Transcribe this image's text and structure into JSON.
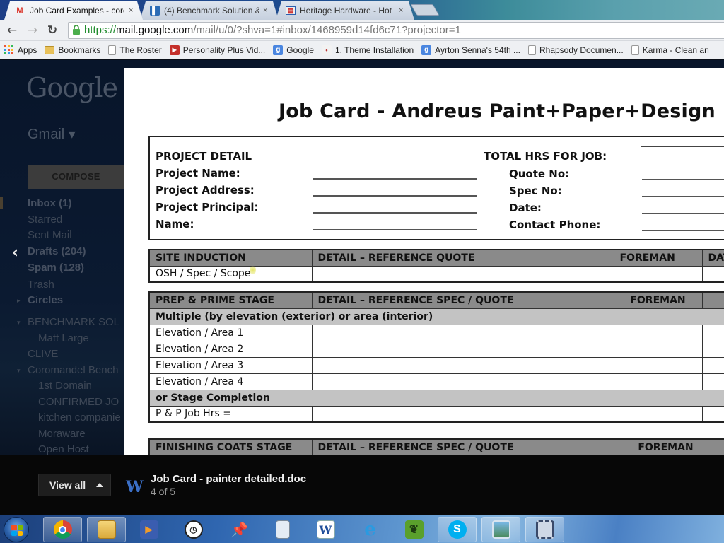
{
  "browser": {
    "tabs": [
      {
        "title": "Job Card Examples - corol",
        "favicon": "gmail-icon",
        "active": true
      },
      {
        "title": "(4) Benchmark Solution &",
        "favicon": "trello-icon",
        "active": false
      },
      {
        "title": "Heritage Hardware - Hot I",
        "favicon": "site-icon",
        "active": false
      }
    ],
    "tab_close_glyph": "×",
    "url": {
      "scheme": "https://",
      "host": "mail.google.com",
      "path": "/mail/u/0/?shva=1#inbox/1468959d14fd6c71?projector=1"
    },
    "nav": {
      "back": "←",
      "forward": "→",
      "reload": "↻"
    },
    "bookmarks": [
      {
        "label": "Apps",
        "icon": "apps-grid-icon"
      },
      {
        "label": "Bookmarks",
        "icon": "folder-icon"
      },
      {
        "label": "The Roster",
        "icon": "page-icon"
      },
      {
        "label": "Personality Plus Vid...",
        "icon": "youtube-icon"
      },
      {
        "label": "Google",
        "icon": "google-icon"
      },
      {
        "label": "1. Theme Installation",
        "icon": "site-icon"
      },
      {
        "label": "Ayrton Senna's 54th ...",
        "icon": "google-icon"
      },
      {
        "label": "Rhapsody Documen...",
        "icon": "page-icon"
      },
      {
        "label": "Karma - Clean an",
        "icon": "page-icon"
      }
    ]
  },
  "gmail": {
    "logo": "Google",
    "app_name": "Gmail ▾",
    "compose_label": "COMPOSE",
    "nav_items": [
      {
        "label": "Inbox (1)",
        "bold": true
      },
      {
        "label": "Starred",
        "bold": false
      },
      {
        "label": "Sent Mail",
        "bold": false
      },
      {
        "label": "Drafts (204)",
        "bold": true
      },
      {
        "label": "Spam (128)",
        "bold": true
      },
      {
        "label": "Trash",
        "bold": false
      },
      {
        "label": "Circles",
        "bold": true
      },
      {
        "label": "BENCHMARK SOL",
        "bold": false
      },
      {
        "label": "Matt Large",
        "bold": false
      },
      {
        "label": "CLIVE",
        "bold": false
      },
      {
        "label": "Coromandel Bench",
        "bold": false
      },
      {
        "label": "1st Domain",
        "bold": false
      },
      {
        "label": "CONFIRMED JO",
        "bold": false
      },
      {
        "label": "kitchen companie",
        "bold": false
      },
      {
        "label": "Moraware",
        "bold": false
      },
      {
        "label": "Open Host",
        "bold": false
      }
    ],
    "prev_arrow": "‹"
  },
  "document": {
    "title": "Job Card  -  Andreus Paint+Paper+Design",
    "project_detail": {
      "heading": "PROJECT DETAIL",
      "left_fields": [
        "Project Name:",
        "Project Address:",
        "Project Principal:",
        "Name:"
      ],
      "total_hrs_label": "TOTAL HRS FOR JOB:",
      "right_fields": [
        "Quote No:",
        "Spec No:",
        "Date:",
        "Contact Phone:"
      ]
    },
    "site_induction": {
      "headers": [
        "SITE INDUCTION",
        "DETAIL – REFERENCE QUOTE",
        "FOREMAN",
        "DAT"
      ],
      "rows": [
        [
          "OSH / Spec / Scope",
          "",
          "",
          ""
        ]
      ]
    },
    "prep_prime": {
      "headers": [
        "PREP & PRIME STAGE",
        "DETAIL – REFERENCE SPEC / QUOTE",
        "FOREMAN",
        ""
      ],
      "subheader_1": "Multiple (by elevation (exterior) or area (interior)",
      "rows": [
        [
          "Elevation / Area 1",
          "",
          "",
          ""
        ],
        [
          "Elevation / Area 2",
          "",
          "",
          ""
        ],
        [
          "Elevation / Area 3",
          "",
          "",
          ""
        ],
        [
          "Elevation / Area 4",
          "",
          "",
          ""
        ]
      ],
      "subheader_2_prefix": "or",
      "subheader_2_rest": " Stage Completion",
      "total_row": [
        "P & P Job Hrs =",
        "",
        "",
        ""
      ]
    },
    "finishing": {
      "headers": [
        "FINISHING COATS STAGE",
        "DETAIL – REFERENCE SPEC / QUOTE",
        "FOREMAN",
        ""
      ]
    }
  },
  "viewer": {
    "view_all_label": "View all",
    "file_icon": "W",
    "file_name": "Job Card - painter detailed.doc",
    "position": "4 of 5"
  },
  "taskbar": {
    "items": [
      {
        "name": "chrome",
        "icon": "chrome-icon",
        "open": true
      },
      {
        "name": "explorer",
        "icon": "folder-icon",
        "open": true
      },
      {
        "name": "media-player",
        "icon": "media-player-icon",
        "open": false
      },
      {
        "name": "clock",
        "icon": "clock-icon",
        "open": false
      },
      {
        "name": "pushpin",
        "icon": "pushpin-icon",
        "open": false
      },
      {
        "name": "calculator",
        "icon": "calculator-icon",
        "open": false
      },
      {
        "name": "word",
        "icon": "word-icon",
        "open": false
      },
      {
        "name": "internet-explorer",
        "icon": "ie-icon",
        "open": false
      },
      {
        "name": "evernote",
        "icon": "evernote-icon",
        "open": false
      },
      {
        "name": "skype",
        "icon": "skype-icon",
        "open": true
      },
      {
        "name": "photo-viewer",
        "icon": "photo-viewer-icon",
        "open": true
      },
      {
        "name": "movie-maker",
        "icon": "movie-maker-icon",
        "open": true
      }
    ]
  }
}
